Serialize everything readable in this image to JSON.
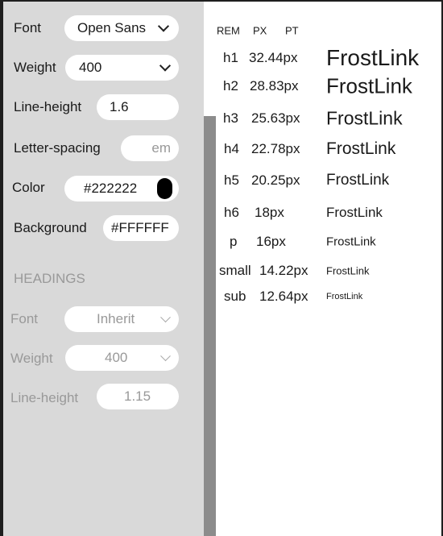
{
  "settings": {
    "font": {
      "label": "Font",
      "value": "Open Sans"
    },
    "weight": {
      "label": "Weight",
      "value": "400"
    },
    "line_height": {
      "label": "Line-height",
      "value": "1.6"
    },
    "letter_spacing": {
      "label": "Letter-spacing",
      "placeholder": "em"
    },
    "color": {
      "label": "Color",
      "value": "#222222",
      "swatch": "#000000"
    },
    "background": {
      "label": "Background",
      "value": "#FFFFFF"
    }
  },
  "headings": {
    "title": "HEADINGS",
    "font": {
      "label": "Font",
      "value": "Inherit"
    },
    "weight": {
      "label": "Weight",
      "value": "400"
    },
    "line_height": {
      "label": "Line-height",
      "value": "1.15"
    }
  },
  "preview": {
    "columns": [
      "REM",
      "PX",
      "PT"
    ],
    "sample": "FrostLink",
    "rows": [
      {
        "tag": "h1",
        "size": "32.44px"
      },
      {
        "tag": "h2",
        "size": "28.83px"
      },
      {
        "tag": "h3",
        "size": "25.63px"
      },
      {
        "tag": "h4",
        "size": "22.78px"
      },
      {
        "tag": "h5",
        "size": "20.25px"
      },
      {
        "tag": "h6",
        "size": "18px"
      },
      {
        "tag": "p",
        "size": "16px"
      },
      {
        "tag": "small",
        "size": "14.22px"
      },
      {
        "tag": "sub",
        "size": "12.64px"
      }
    ]
  }
}
